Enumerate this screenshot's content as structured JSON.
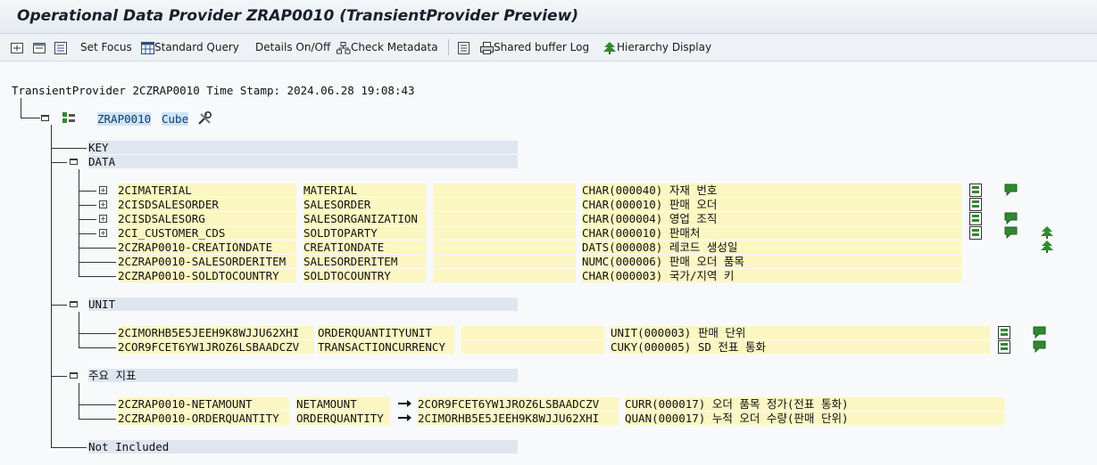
{
  "window": {
    "title": "Operational Data Provider ZRAP0010 (TransientProvider Preview)"
  },
  "toolbar": {
    "set_focus": "Set Focus",
    "standard_query": "Standard Query",
    "details": "Details On/Off",
    "check_metadata": "Check Metadata",
    "shared_buffer": "Shared buffer Log",
    "hierarchy": "Hierarchy Display"
  },
  "header": {
    "text": "TransientProvider 2CZRAP0010 Time Stamp: 2024.06.28 19:08:43"
  },
  "cube": {
    "name": "ZRAP0010",
    "type": "Cube"
  },
  "nodes": {
    "key": "KEY",
    "data": "DATA",
    "unit": "UNIT",
    "kf": "주요 지표",
    "not_included": "Not Included"
  },
  "data_rows": [
    {
      "name": "2CIMATERIAL",
      "field": "MATERIAL",
      "ref": "",
      "type": "CHAR(000040)",
      "desc": "자재 번호"
    },
    {
      "name": "2CISDSALESORDER",
      "field": "SALESORDER",
      "ref": "",
      "type": "CHAR(000010)",
      "desc": "판매 오더"
    },
    {
      "name": "2CISDSALESORG",
      "field": "SALESORGANIZATION",
      "ref": "",
      "type": "CHAR(000004)",
      "desc": "영업 조직"
    },
    {
      "name": "2CI_CUSTOMER_CDS",
      "field": "SOLDTOPARTY",
      "ref": "",
      "type": "CHAR(000010)",
      "desc": "판매처"
    },
    {
      "name": "2CZRAP0010-CREATIONDATE",
      "field": "CREATIONDATE",
      "ref": "",
      "type": "DATS(000008)",
      "desc": "레코드 생성일"
    },
    {
      "name": "2CZRAP0010-SALESORDERITEM",
      "field": "SALESORDERITEM",
      "ref": "",
      "type": "NUMC(000006)",
      "desc": "판매 오더 품목"
    },
    {
      "name": "2CZRAP0010-SOLDTOCOUNTRY",
      "field": "SOLDTOCOUNTRY",
      "ref": "",
      "type": "CHAR(000003)",
      "desc": "국가/지역 키"
    }
  ],
  "unit_rows": [
    {
      "name": "2CIMORHB5E5JEEH9K8WJJU62XHI",
      "field": "ORDERQUANTITYUNIT",
      "ref": "",
      "type": "UNIT(000003)",
      "desc": "판매 단위"
    },
    {
      "name": "2COR9FCET6YW1JROZ6LSBAADCZV",
      "field": "TRANSACTIONCURRENCY",
      "ref": "",
      "type": "CUKY(000005)",
      "desc": "SD 전표 통화"
    }
  ],
  "kf_rows": [
    {
      "name": "2CZRAP0010-NETAMOUNT",
      "field": "NETAMOUNT",
      "unit": "2COR9FCET6YW1JROZ6LSBAADCZV",
      "type": "CURR(000017)",
      "desc": "오더 품목 정가(전표 통화)"
    },
    {
      "name": "2CZRAP0010-ORDERQUANTITY",
      "field": "ORDERQUANTITY",
      "unit": "2CIMORHB5E5JEEH9K8WJJU62XHI",
      "type": "QUAN(000017)",
      "desc": "누적 오더 수량(판매 단위)"
    }
  ],
  "colors": {
    "field_bg": "#fbf6c2",
    "node_bg": "#dfe6f0",
    "accent_green": "#2f8a2f"
  }
}
